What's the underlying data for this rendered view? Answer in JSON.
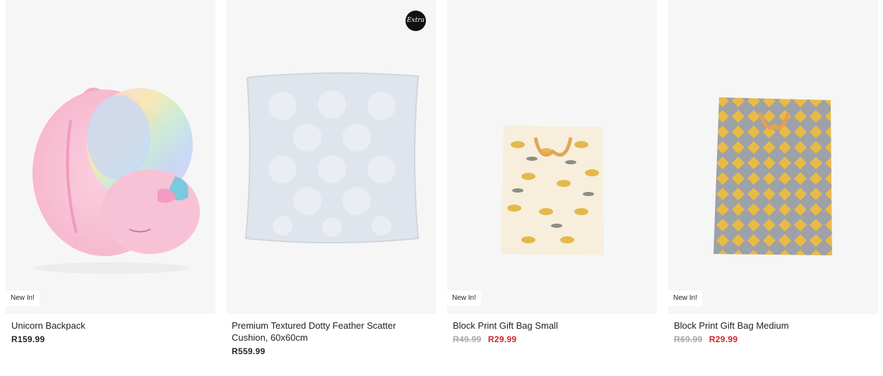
{
  "products": [
    {
      "title": "Unicorn Backpack",
      "badge": "New In!",
      "price": "R159.99",
      "image": "unicorn-backpack-image"
    },
    {
      "title": "Premium Textured Dotty Feather Scatter Cushion, 60x60cm",
      "badge": "",
      "logo": "Extra",
      "price": "R559.99",
      "image": "grey-cushion-image"
    },
    {
      "title": "Block Print Gift Bag Small",
      "badge": "New In!",
      "old_price": "R49.99",
      "sale_price": "R29.99",
      "image": "yellow-leaf-gift-bag-image"
    },
    {
      "title": "Block Print Gift Bag Medium",
      "badge": "New In!",
      "old_price": "R69.99",
      "sale_price": "R29.99",
      "image": "yellow-diamond-gift-bag-image"
    }
  ],
  "colors": {
    "card_background": "#f6f6f6",
    "sale_price": "#d1232a",
    "old_price": "#a9a9a9",
    "text": "#222222"
  }
}
